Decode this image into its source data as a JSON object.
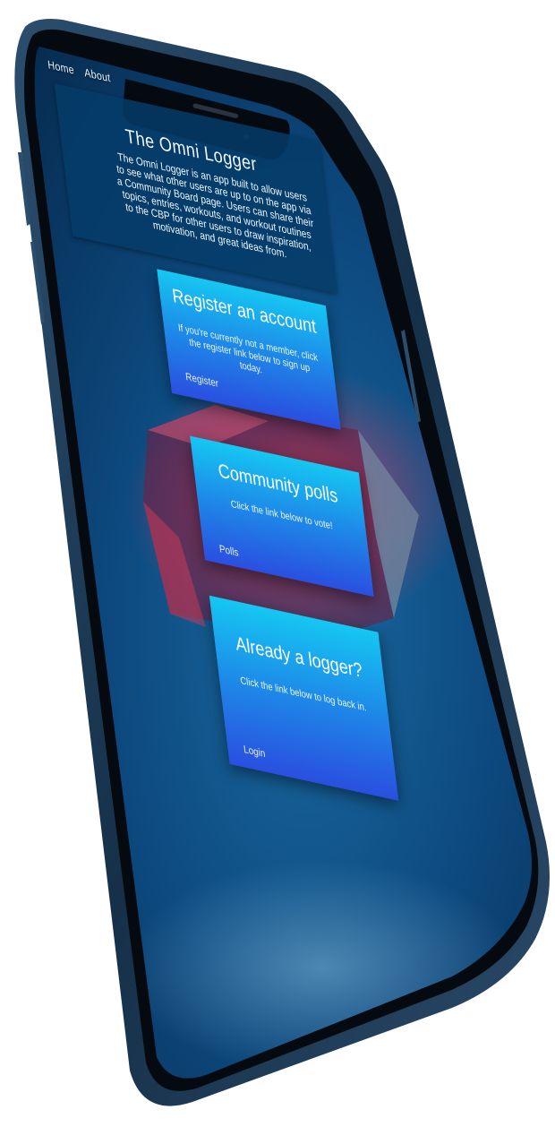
{
  "nav": {
    "home": "Home",
    "about": "About"
  },
  "header": {
    "title": "The Omni Logger",
    "description": "The Omni Logger is an app built to allow users to see what other users are up to on the app via a Community Board page. Users can share their topics, entries, workouts, and workout routines to the CBP for other users to draw inspiration, motivation, and great ideas from."
  },
  "cards": {
    "register": {
      "title": "Register an account",
      "text": "If you're currently not a member, click the register link below to sign up today.",
      "link": "Register"
    },
    "polls": {
      "title": "Community polls",
      "text": "Click the link below to vote!",
      "link": "Polls"
    },
    "login": {
      "title": "Already a logger?",
      "text": "Click the link below to log back in.",
      "link": "Login"
    }
  },
  "colors": {
    "phone_frame": "#1d3a55",
    "screen_bg": "#0a3d6b",
    "card_top": "#15c7f2",
    "card_bottom": "#2a4fe0",
    "header_panel": "#053c69"
  }
}
